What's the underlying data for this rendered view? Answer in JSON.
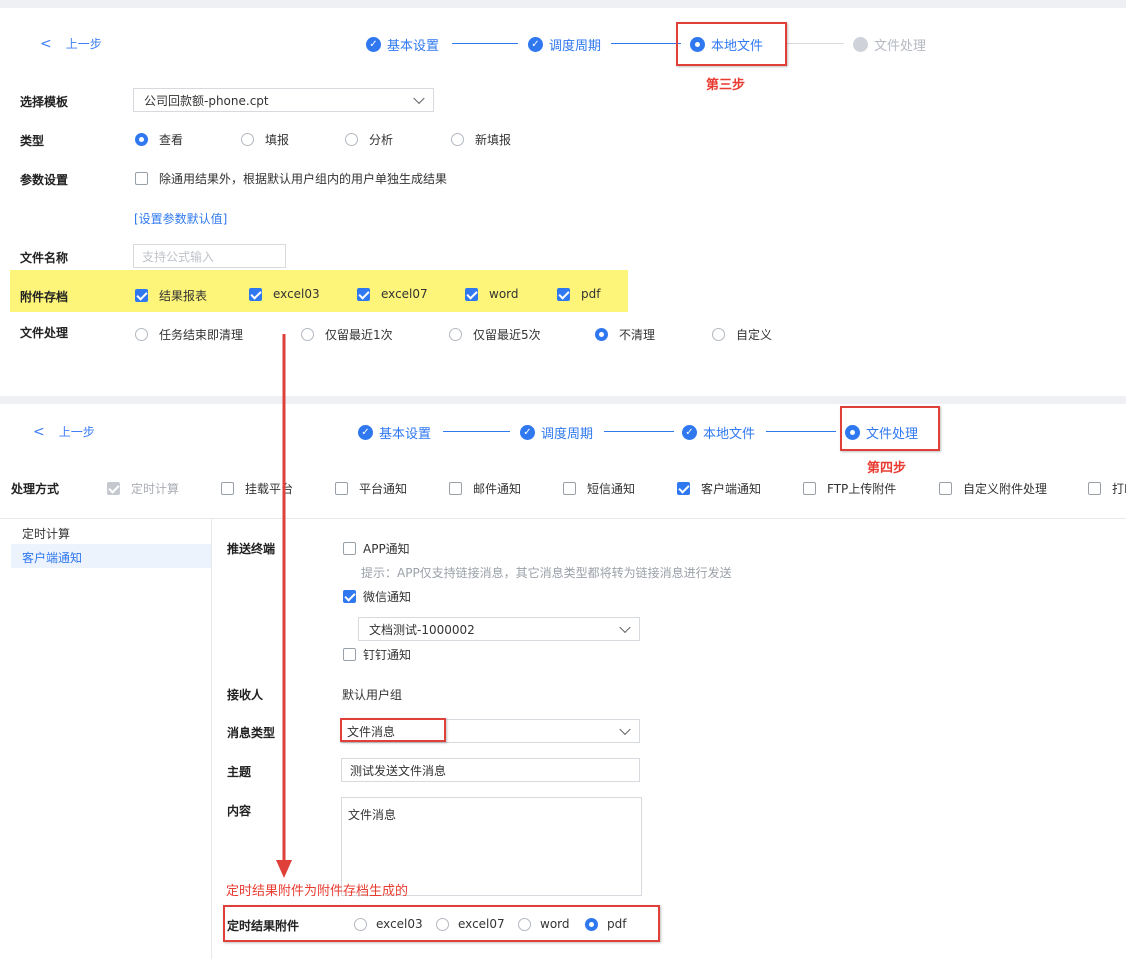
{
  "top": {
    "back_label": "上一步",
    "steps": [
      {
        "label": "基本设置",
        "state": "done"
      },
      {
        "label": "调度周期",
        "state": "done"
      },
      {
        "label": "本地文件",
        "state": "current"
      },
      {
        "label": "文件处理",
        "state": "todo"
      }
    ],
    "annotation": "第三步",
    "form": {
      "template_label": "选择模板",
      "template_value": "公司回款额-phone.cpt",
      "type_label": "类型",
      "type_options": [
        "查看",
        "填报",
        "分析",
        "新填报"
      ],
      "type_selected": "查看",
      "param_label": "参数设置",
      "param_checkbox_label": "除通用结果外，根据默认用户组内的用户单独生成结果",
      "param_link": "[设置参数默认值]",
      "filename_label": "文件名称",
      "filename_placeholder": "支持公式输入",
      "archive_label": "附件存档",
      "archive_options": [
        "结果报表",
        "excel03",
        "excel07",
        "word",
        "pdf"
      ],
      "fileproc_label": "文件处理",
      "fileproc_options": [
        "任务结束即清理",
        "仅留最近1次",
        "仅留最近5次",
        "不清理",
        "自定义"
      ],
      "fileproc_selected": "不清理"
    }
  },
  "bottom": {
    "back_label": "上一步",
    "steps": [
      {
        "label": "基本设置",
        "state": "done"
      },
      {
        "label": "调度周期",
        "state": "done"
      },
      {
        "label": "本地文件",
        "state": "done"
      },
      {
        "label": "文件处理",
        "state": "current"
      }
    ],
    "annotation": "第四步",
    "method_label": "处理方式",
    "methods": [
      {
        "label": "定时计算",
        "checked": true,
        "disabled": true
      },
      {
        "label": "挂载平台",
        "checked": false
      },
      {
        "label": "平台通知",
        "checked": false
      },
      {
        "label": "邮件通知",
        "checked": false
      },
      {
        "label": "短信通知",
        "checked": false
      },
      {
        "label": "客户端通知",
        "checked": true
      },
      {
        "label": "FTP上传附件",
        "checked": false
      },
      {
        "label": "自定义附件处理",
        "checked": false
      },
      {
        "label": "打印",
        "checked": false
      }
    ],
    "sidebar": [
      "定时计算",
      "客户端通知"
    ],
    "push_label": "推送终端",
    "app_notice": "APP通知",
    "hint": "提示：APP仅支持链接消息，其它消息类型都将转为链接消息进行发送",
    "wechat_notice": "微信通知",
    "wechat_select": "文档测试-1000002",
    "dingtalk_notice": "钉钉通知",
    "receiver_label": "接收人",
    "receiver_value": "默认用户组",
    "msgtype_label": "消息类型",
    "msgtype_value": "文件消息",
    "subject_label": "主题",
    "subject_value": "测试发送文件消息",
    "content_label": "内容",
    "content_value": "文件消息",
    "red_note": "定时结果附件为附件存档生成的",
    "attach_label": "定时结果附件",
    "attach_options": [
      "excel03",
      "excel07",
      "word",
      "pdf"
    ],
    "attach_selected": "pdf"
  }
}
